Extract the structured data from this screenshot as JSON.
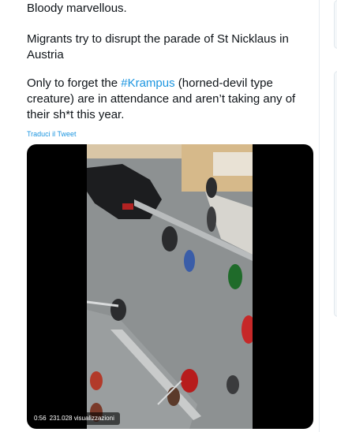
{
  "tweet": {
    "para1": "Bloody marvellous.",
    "para2": "Migrants try to disrupt the parade of St Nicklaus in Austria",
    "para3_before": "Only to forget the ",
    "para3_hashtag": "#Krampus",
    "para3_after": " (horned-devil type creature) are in attendance and aren’t taking any of their sh*t this year.",
    "translate_label": "Traduci il Tweet"
  },
  "video": {
    "duration": "0:56",
    "views": "231.028 visualizzazioni"
  }
}
